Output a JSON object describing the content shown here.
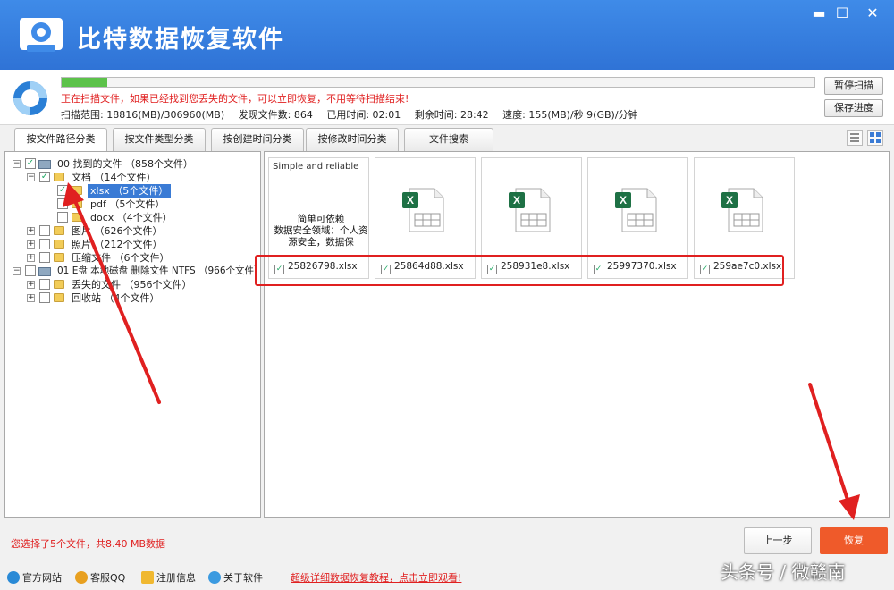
{
  "window": {
    "title": "比特数据恢复软件",
    "buttons": {
      "minimize": "▬",
      "maximize": "☐",
      "close": "✕"
    }
  },
  "scan": {
    "progress_fraction": 0.06,
    "warning": "正在扫描文件，如果已经找到您丢失的文件，可以立即恢复，不用等待扫描结束!",
    "range_label": "扫描范围: 18816(MB)/306960(MB)",
    "found_label": "发现文件数: 864",
    "elapsed_label": "已用时间: 02:01",
    "remaining_label": "剩余时间: 28:42",
    "speed_label": "速度: 155(MB)/秒  9(GB)/分钟",
    "pause_button": "暂停扫描",
    "save_button": "保存进度"
  },
  "tabs": [
    {
      "label": "按文件路径分类"
    },
    {
      "label": "按文件类型分类"
    },
    {
      "label": "按创建时间分类"
    },
    {
      "label": "按修改时间分类"
    },
    {
      "label": "文件搜索"
    }
  ],
  "tree": {
    "root1": "00 找到的文件 （858个文件）",
    "docs": "文档    （14个文件）",
    "xlsx": "xlsx    （5个文件）",
    "pdf": "pdf     （5个文件）",
    "docx": "docx    （4个文件）",
    "images": "图片    （626个文件）",
    "photos": "照片    （212个文件）",
    "archives": "压缩文件    （6个文件）",
    "root2": "01 E盘 本地磁盘 删除文件 NTFS （966个文件）",
    "lost": "丢失的文件    （956个文件）",
    "recycle": "回收站    （4个文件）"
  },
  "files": [
    {
      "name": "25826798.xlsx",
      "preview_en": "Simple and reliable",
      "preview_cn": "简单可依赖\n数据安全领域：个人资源安全，数据保"
    },
    {
      "name": "25864d88.xlsx"
    },
    {
      "name": "258931e8.xlsx"
    },
    {
      "name": "25997370.xlsx"
    },
    {
      "name": "259ae7c0.xlsx"
    }
  ],
  "selection_info": "您选择了5个文件，共8.40 MB数据",
  "buttons": {
    "prev": "上一步",
    "recover": "恢复"
  },
  "statusbar": {
    "website": "官方网站",
    "qq": "客服QQ",
    "register": "注册信息",
    "about": "关于软件",
    "promo": "超级详细数据恢复教程，点击立即观看!"
  },
  "watermark": "头条号 / 微赣南",
  "colors": {
    "title_blue": "#2f73d6",
    "progress_green": "#5cc24a",
    "alert_red": "#e02020",
    "recover_orange": "#ef5a2a",
    "excel_green": "#1e7145"
  }
}
